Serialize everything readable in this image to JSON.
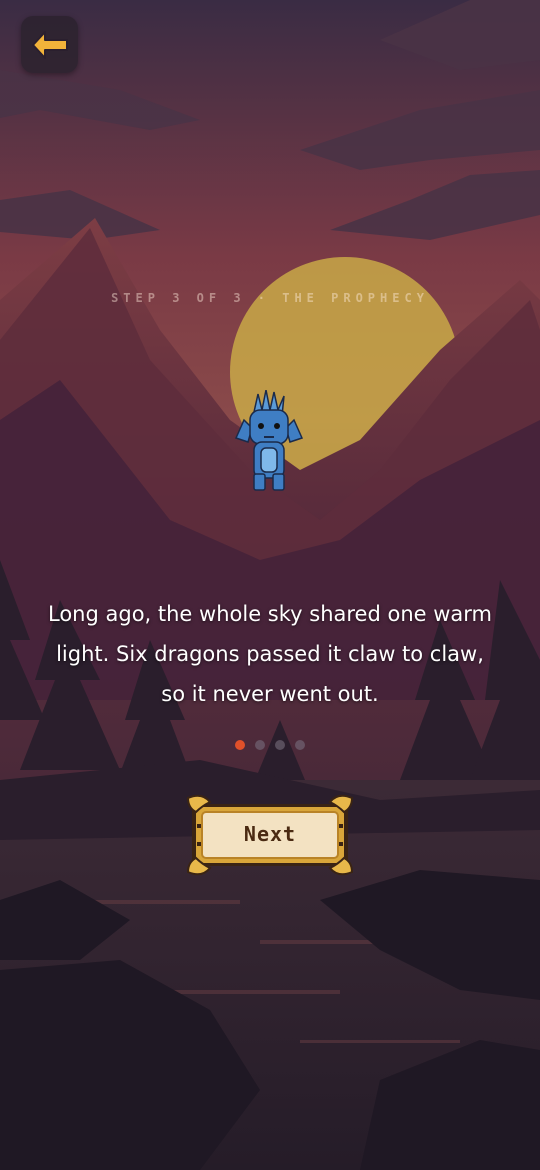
{
  "header": {
    "back_icon": "arrow-left-icon",
    "accent_color": "#f2b33a"
  },
  "onboarding": {
    "step_label": "STEP 3 OF 3 · THE PROPHECY",
    "story_lines": [
      "Long ago, the whole sky shared one warm",
      "light. Six dragons passed it claw to claw,",
      "so it never went out."
    ],
    "pagination": {
      "total": 4,
      "active_index": 0,
      "active_color": "#e0502a"
    },
    "next_label": "Next"
  },
  "scene": {
    "sky_top": "#3a2c44",
    "sky_glow": "#7a3a45",
    "sun_color": "#c9a948",
    "mountain_color": "#6e3440",
    "water_color": "#2b2230"
  },
  "character": {
    "name": "dragon-icon",
    "color": "#3f7ec4"
  }
}
